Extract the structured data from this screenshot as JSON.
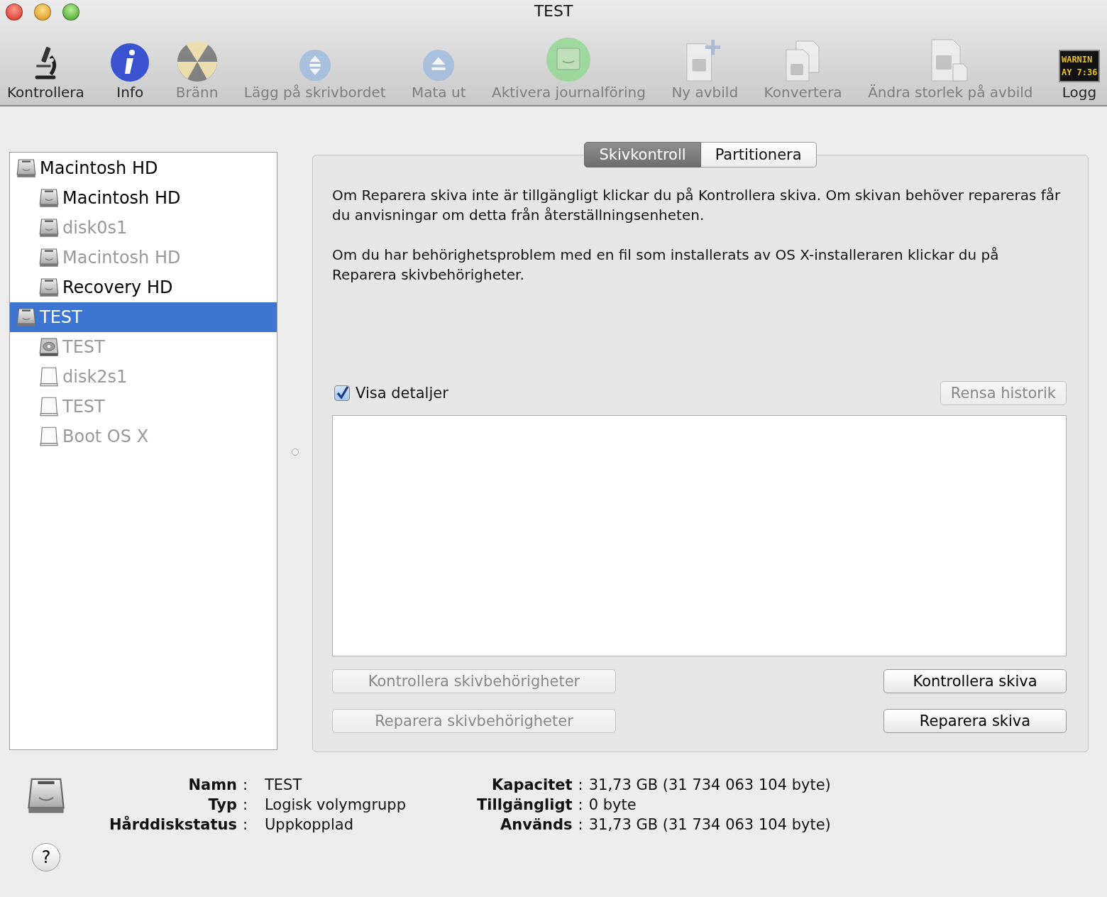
{
  "window": {
    "title": "TEST"
  },
  "toolbar": [
    {
      "label": "Kontrollera",
      "kind": "microscope",
      "disabled": false
    },
    {
      "label": "Info",
      "kind": "info",
      "disabled": false
    },
    {
      "label": "Bränn",
      "kind": "burn",
      "disabled": true
    },
    {
      "label": "Lägg på skrivbordet",
      "kind": "mount",
      "disabled": true
    },
    {
      "label": "Mata ut",
      "kind": "eject",
      "disabled": true
    },
    {
      "label": "Aktivera journalföring",
      "kind": "journal",
      "disabled": true
    },
    {
      "label": "Ny avbild",
      "kind": "newimage",
      "disabled": true
    },
    {
      "label": "Konvertera",
      "kind": "convert",
      "disabled": true
    },
    {
      "label": "Ändra storlek på avbild",
      "kind": "resize",
      "disabled": true
    },
    {
      "label": "Logg",
      "kind": "log",
      "disabled": false,
      "screen_text": [
        "WARNIN",
        "AY 7:36"
      ]
    }
  ],
  "sidebar": {
    "items": [
      {
        "label": "Macintosh HD",
        "kind": "hd",
        "disabled": false,
        "selected": false,
        "children": [
          {
            "label": "Macintosh HD",
            "kind": "hd",
            "disabled": false,
            "selected": false
          },
          {
            "label": "disk0s1",
            "kind": "hd",
            "disabled": true,
            "selected": false
          },
          {
            "label": "Macintosh HD",
            "kind": "hd",
            "disabled": true,
            "selected": false
          },
          {
            "label": "Recovery HD",
            "kind": "hd",
            "disabled": false,
            "selected": false
          }
        ]
      },
      {
        "label": "TEST",
        "kind": "hd",
        "disabled": false,
        "selected": true,
        "children": [
          {
            "label": "TEST",
            "kind": "logical",
            "disabled": true,
            "selected": false
          },
          {
            "label": "disk2s1",
            "kind": "external",
            "disabled": true,
            "selected": false
          },
          {
            "label": "TEST",
            "kind": "external",
            "disabled": true,
            "selected": false
          },
          {
            "label": "Boot OS X",
            "kind": "external",
            "disabled": true,
            "selected": false
          }
        ]
      }
    ]
  },
  "tabs": [
    {
      "label": "Skivkontroll",
      "selected": true
    },
    {
      "label": "Partitionera",
      "selected": false
    }
  ],
  "first_aid": {
    "paragraphs": [
      "Om Reparera skiva inte är tillgängligt klickar du på Kontrollera skiva. Om skivan behöver repareras får du anvisningar om detta från återställningsenheten.",
      "Om du har behörighetsproblem med en fil som installerats av OS X-installeraren klickar du på Reparera skivbehörigheter."
    ],
    "show_details": {
      "label": "Visa detaljer",
      "checked": true
    },
    "clear_history": {
      "label": "Rensa historik",
      "disabled": true
    },
    "actions": [
      {
        "label": "Kontrollera skivbehörigheter",
        "disabled": true
      },
      {
        "label": "Kontrollera skiva",
        "disabled": false
      },
      {
        "label": "Reparera skivbehörigheter",
        "disabled": true
      },
      {
        "label": "Reparera skiva",
        "disabled": false
      }
    ]
  },
  "info": {
    "left": [
      {
        "label": "Namn",
        "value": "TEST"
      },
      {
        "label": "Typ",
        "value": "Logisk volymgrupp"
      },
      {
        "label": "Hårddiskstatus",
        "value": "Uppkopplad"
      }
    ],
    "right": [
      {
        "label": "Kapacitet",
        "value": "31,73 GB (31 734 063 104 byte)"
      },
      {
        "label": "Tillgängligt",
        "value": "0 byte"
      },
      {
        "label": "Används",
        "value": "31,73 GB (31 734 063 104 byte)"
      }
    ],
    "separator": ":",
    "help": "?"
  }
}
